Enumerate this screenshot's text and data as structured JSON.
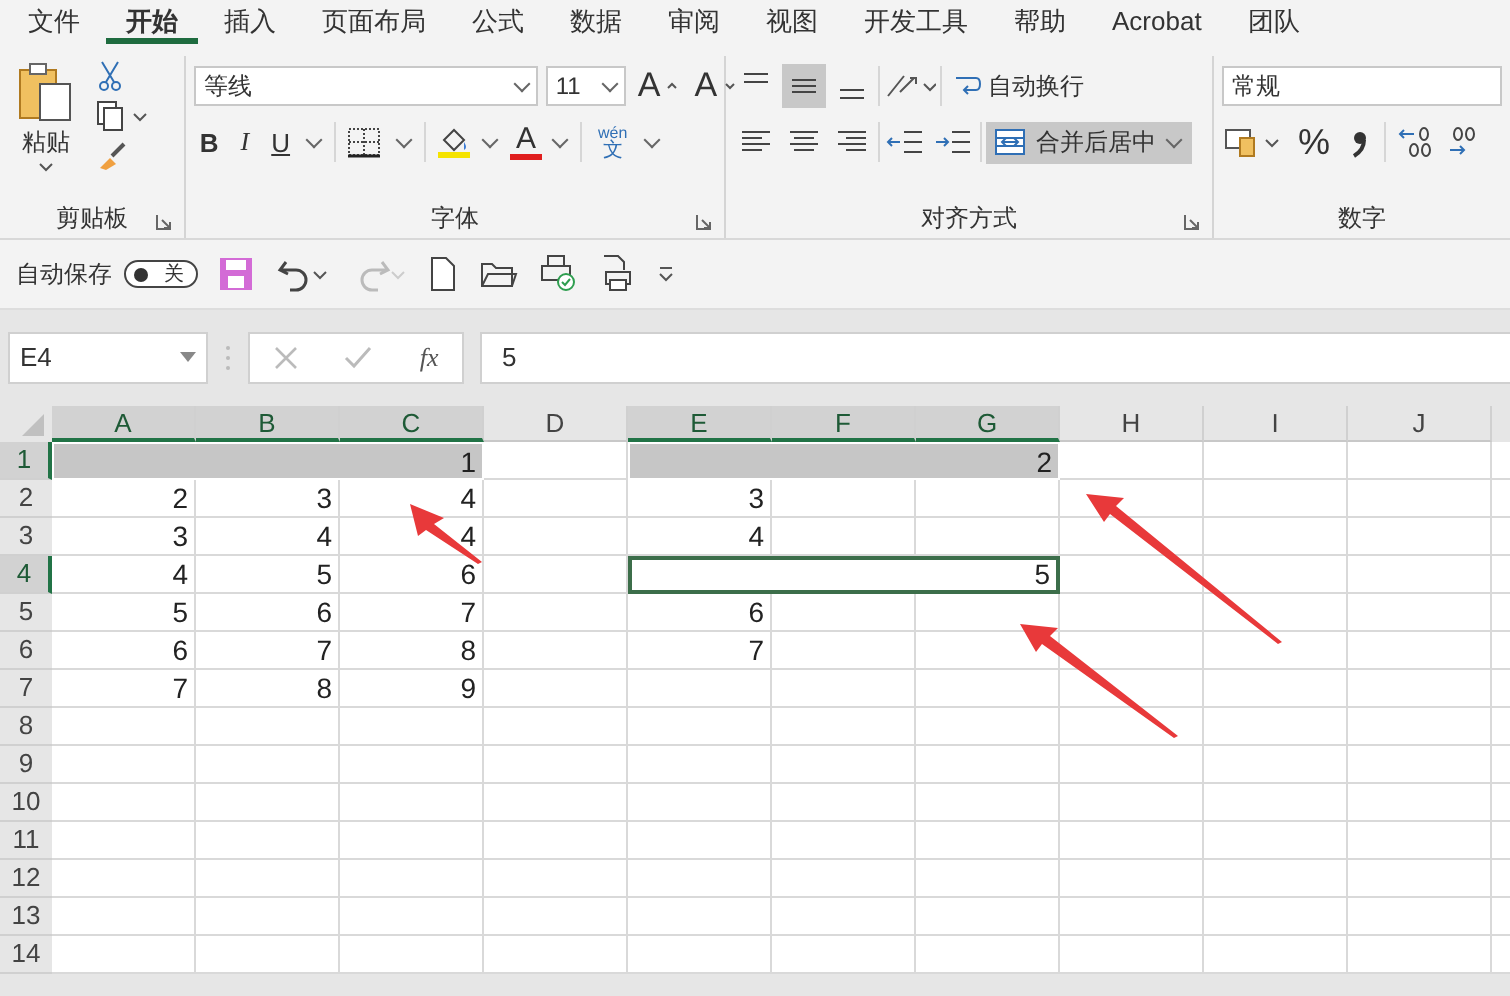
{
  "menu_tabs": [
    {
      "label": "文件",
      "selected": false
    },
    {
      "label": "开始",
      "selected": true
    },
    {
      "label": "插入",
      "selected": false
    },
    {
      "label": "页面布局",
      "selected": false
    },
    {
      "label": "公式",
      "selected": false
    },
    {
      "label": "数据",
      "selected": false
    },
    {
      "label": "审阅",
      "selected": false
    },
    {
      "label": "视图",
      "selected": false
    },
    {
      "label": "开发工具",
      "selected": false
    },
    {
      "label": "帮助",
      "selected": false
    },
    {
      "label": "Acrobat",
      "selected": false
    },
    {
      "label": "团队",
      "selected": false
    }
  ],
  "ribbon": {
    "clipboard": {
      "label": "剪贴板",
      "paste_label": "粘贴"
    },
    "font": {
      "label": "字体",
      "font_name": "等线",
      "font_size": "11",
      "grow_label": "A",
      "shrink_label": "A",
      "bold_label": "B",
      "italic_label": "I",
      "underline_label": "U",
      "font_color_label": "A",
      "phonetic_top": "wén",
      "phonetic_bottom": "文"
    },
    "alignment": {
      "label": "对齐方式",
      "vertical_align": [
        {
          "selected": false
        },
        {
          "selected": true
        },
        {
          "selected": false
        }
      ],
      "wrap_text": "自动换行",
      "merge_center": {
        "label": "合并后居中",
        "selected": true
      }
    },
    "number": {
      "label": "数字",
      "format": "常规",
      "percent": "%"
    }
  },
  "quick_access": {
    "autosave_label": "自动保存",
    "autosave_toggle": {
      "label": "关",
      "on": false
    },
    "redo_disabled": true
  },
  "formula_bar": {
    "name_box": "E4",
    "fx": "fx",
    "value": "5"
  },
  "sheet": {
    "columns": [
      {
        "label": "A",
        "selected": true
      },
      {
        "label": "B",
        "selected": true
      },
      {
        "label": "C",
        "selected": true
      },
      {
        "label": "D",
        "selected": false
      },
      {
        "label": "E",
        "selected": true
      },
      {
        "label": "F",
        "selected": true
      },
      {
        "label": "G",
        "selected": true
      },
      {
        "label": "H",
        "selected": false
      },
      {
        "label": "I",
        "selected": false
      },
      {
        "label": "J",
        "selected": false
      }
    ],
    "rows": [
      {
        "header": "1",
        "selected": true,
        "cells": [
          {
            "kind": "merge_start",
            "value": "1",
            "selected": true
          },
          {
            "kind": "merge_part"
          },
          {
            "kind": "merge_part"
          },
          {},
          {
            "kind": "merge_start",
            "value": "2",
            "selected": true
          },
          {
            "kind": "merge_part"
          },
          {
            "kind": "merge_part"
          }
        ]
      },
      {
        "header": "2",
        "selected": false,
        "cells": [
          {
            "value": "2"
          },
          {
            "value": "3"
          },
          {
            "value": "4"
          },
          {},
          {
            "value": "3"
          }
        ]
      },
      {
        "header": "3",
        "selected": false,
        "cells": [
          {
            "value": "3"
          },
          {
            "value": "4"
          },
          {
            "value": "4"
          },
          {},
          {
            "value": "4"
          }
        ]
      },
      {
        "header": "4",
        "selected": true,
        "cells": [
          {
            "value": "4"
          },
          {
            "value": "5"
          },
          {
            "value": "6"
          },
          {},
          {
            "kind": "merge_start",
            "value": "5",
            "active": true
          },
          {
            "kind": "merge_part"
          },
          {
            "kind": "merge_part"
          }
        ]
      },
      {
        "header": "5",
        "selected": false,
        "cells": [
          {
            "value": "5"
          },
          {
            "value": "6"
          },
          {
            "value": "7"
          },
          {},
          {
            "value": "6"
          }
        ]
      },
      {
        "header": "6",
        "selected": false,
        "cells": [
          {
            "value": "6"
          },
          {
            "value": "7"
          },
          {
            "value": "8"
          },
          {},
          {
            "value": "7"
          }
        ]
      },
      {
        "header": "7",
        "selected": false,
        "cells": [
          {
            "value": "7"
          },
          {
            "value": "8"
          },
          {
            "value": "9"
          }
        ]
      },
      {
        "header": "8",
        "selected": false
      },
      {
        "header": "9",
        "selected": false
      },
      {
        "header": "10",
        "selected": false
      },
      {
        "header": "11",
        "selected": false
      },
      {
        "header": "12",
        "selected": false
      },
      {
        "header": "13",
        "selected": false
      },
      {
        "header": "14",
        "selected": false
      }
    ]
  }
}
